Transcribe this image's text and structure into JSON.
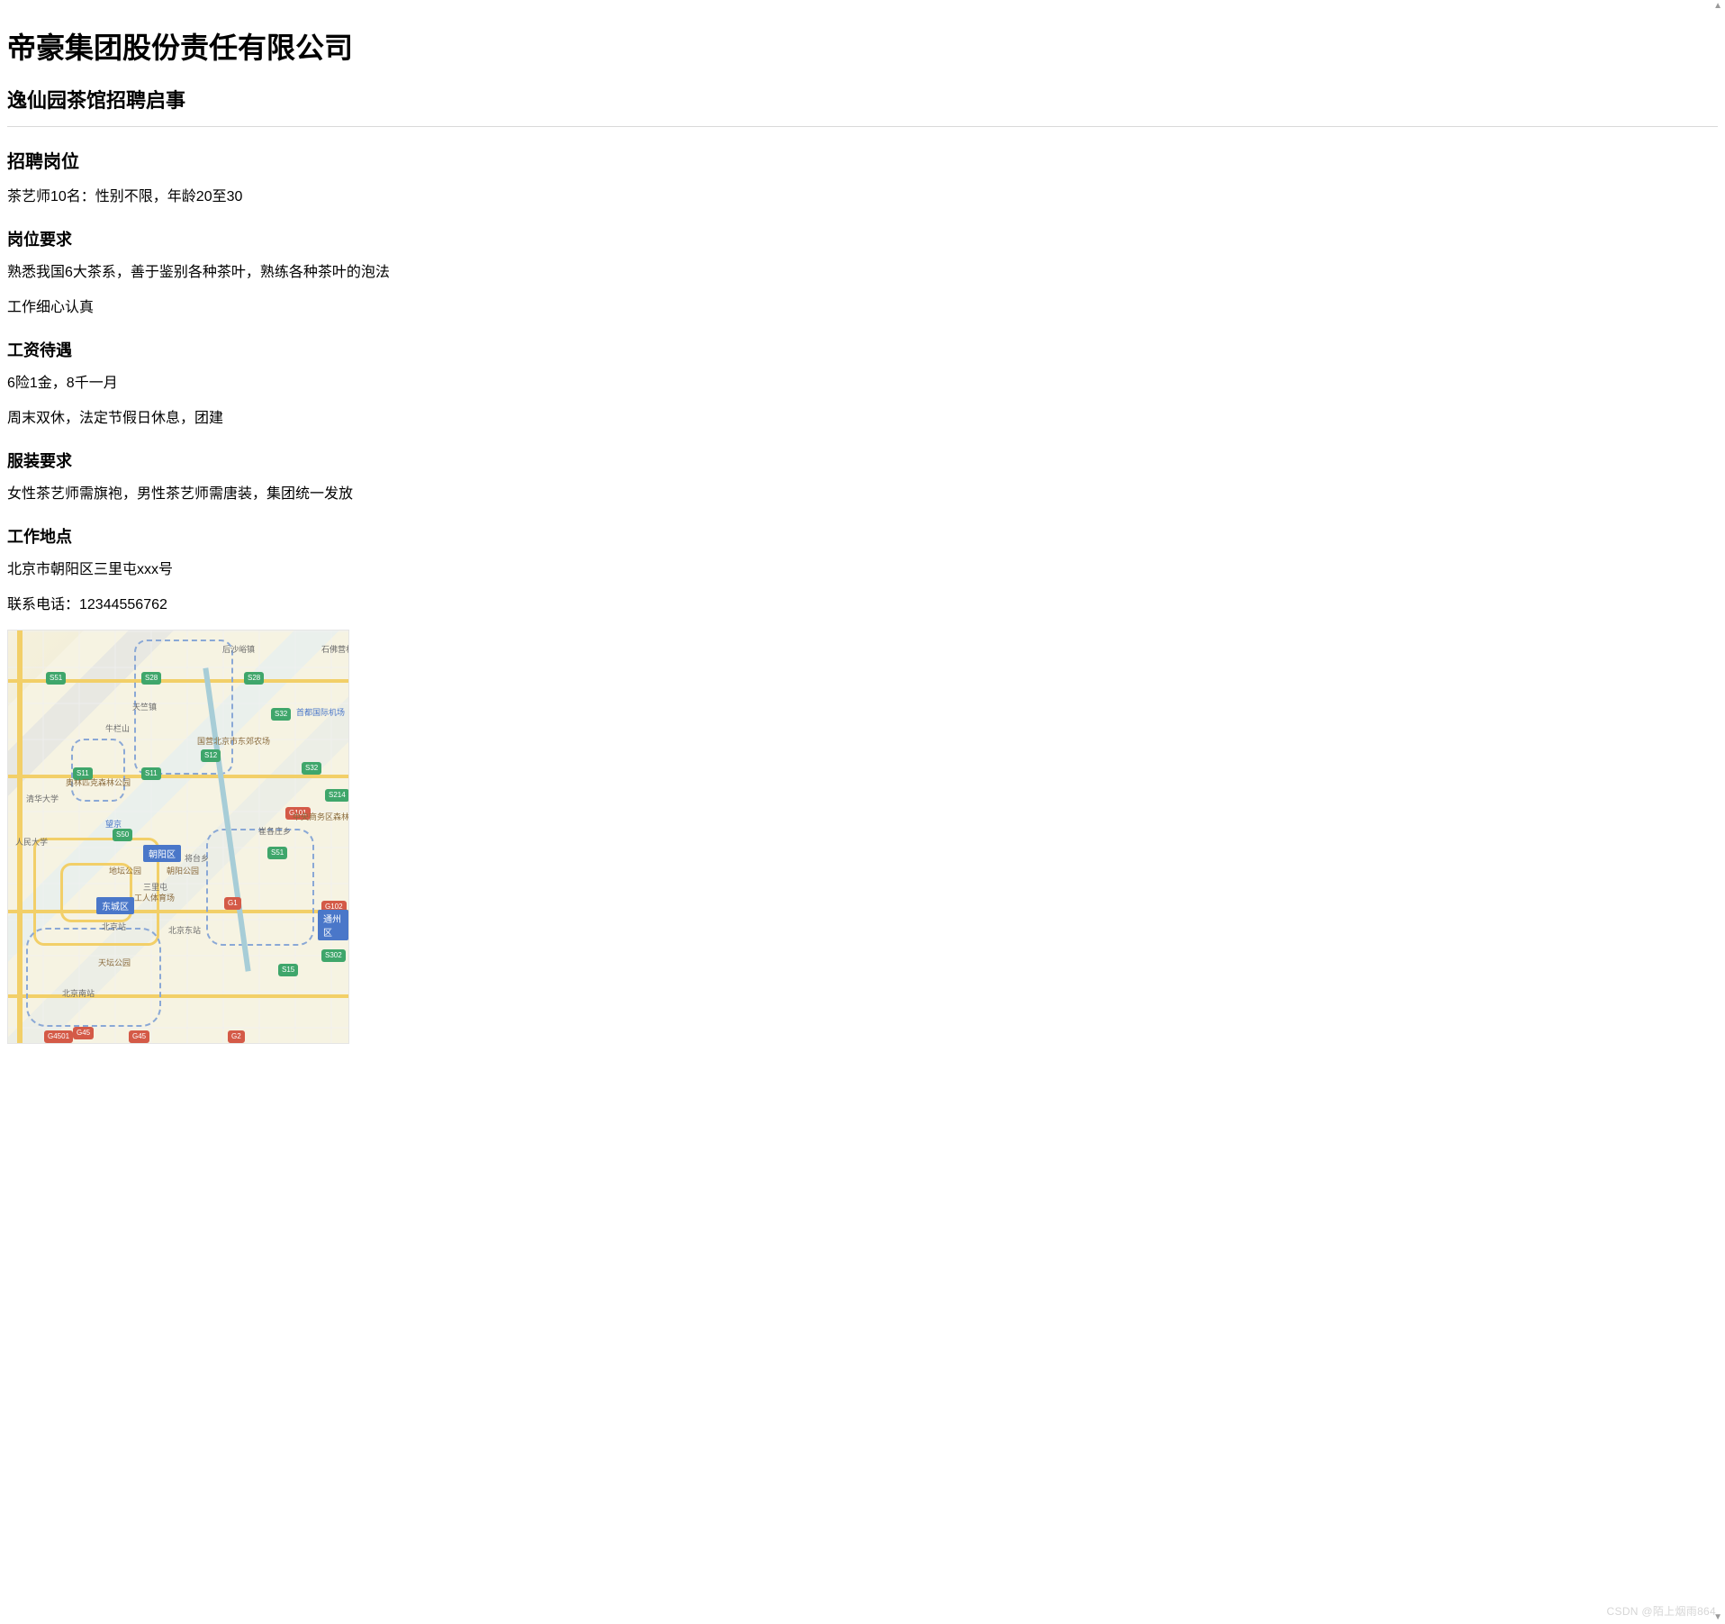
{
  "company": {
    "name": "帝豪集团股份责任有限公司",
    "subtitle": "逸仙园茶馆招聘启事"
  },
  "sections": {
    "positions": {
      "heading": "招聘岗位",
      "line1": "茶艺师10名：性别不限，年龄20至30"
    },
    "requirements": {
      "heading": "岗位要求",
      "line1": "熟悉我国6大茶系，善于鉴别各种茶叶，熟练各种茶叶的泡法",
      "line2": "工作细心认真"
    },
    "salary": {
      "heading": "工资待遇",
      "line1": "6险1金，8千一月",
      "line2": "周末双休，法定节假日休息，团建"
    },
    "dress": {
      "heading": "服装要求",
      "line1": "女性茶艺师需旗袍，男性茶艺师需唐装，集团统一发放"
    },
    "location": {
      "heading": "工作地点",
      "line1": "北京市朝阳区三里屯xxx号",
      "line2": "联系电话：12344556762"
    }
  },
  "map": {
    "districts": {
      "chaoyang": "朝阳区",
      "dongcheng": "东城区",
      "tongzhou": "通州区"
    },
    "places": {
      "airport": "首都国际机场",
      "shunyi_farm": "国营北京市东郊农场",
      "zhongyang_forest": "中央商务区森林公园",
      "huilongguan": "后沙峪镇",
      "shifoying": "石佛营村",
      "tianzhu": "天竺镇",
      "cuigezhuang": "崔各庄乡",
      "jiangtai": "将台乡",
      "sanlitun": "三里屯",
      "olympic_park": "奥林匹克森林公园",
      "workers_stadium": "工人体育场",
      "chaoyang_park": "朝阳公园",
      "qinghua": "清华大学",
      "renmin": "人民大学",
      "niulanshan": "牛栏山"
    },
    "roads": {
      "s28": "S28",
      "s51": "S51",
      "s11": "S11",
      "s32": "S32",
      "s12": "S12",
      "s50": "S50",
      "s214": "S214",
      "g101": "G101",
      "g45": "G45",
      "g102": "G102",
      "g1": "G1",
      "s15": "S15",
      "g2": "G2",
      "s302": "S302",
      "g4501": "G4501"
    },
    "others": {
      "beijing_station": "北京站",
      "beijing_east": "北京东站",
      "beijing_south": "北京南站",
      "wangjing": "望京",
      "tiantan": "天坛公园",
      "ditan": "地坛公园"
    }
  },
  "watermark": "CSDN @陌上烟雨864"
}
